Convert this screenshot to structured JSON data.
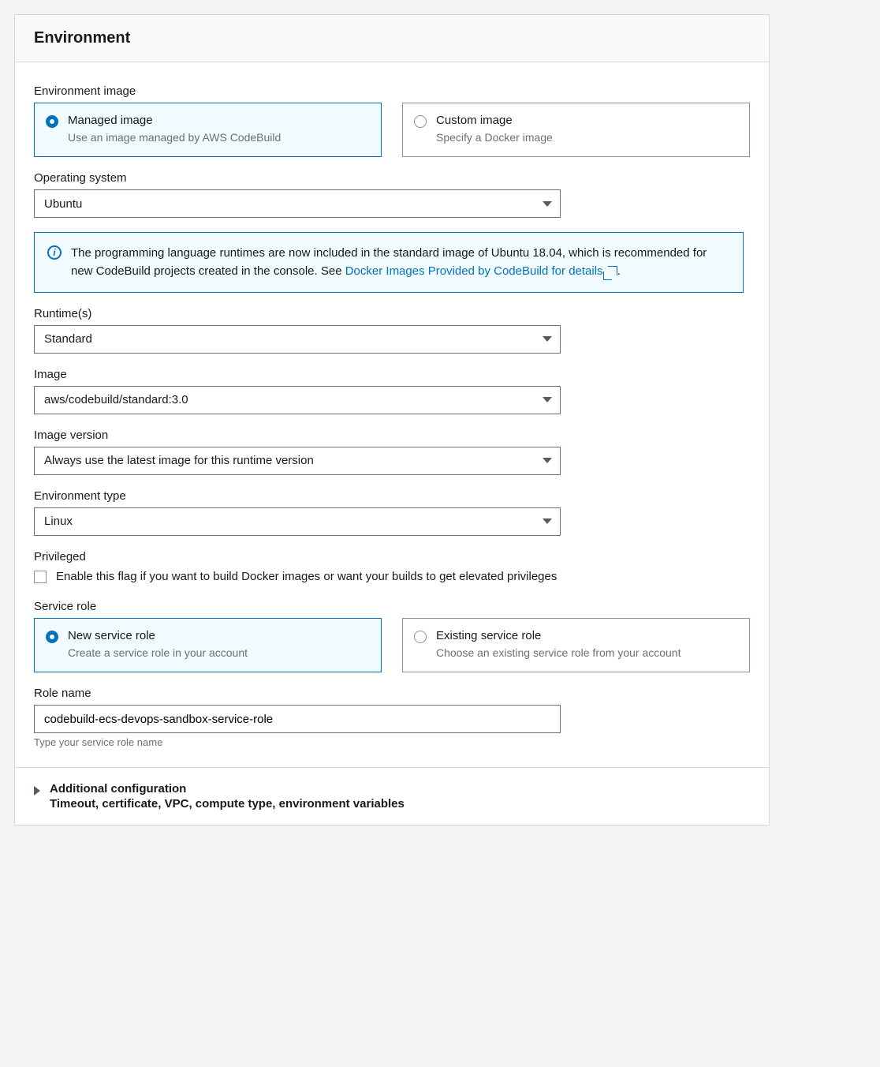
{
  "header": {
    "title": "Environment"
  },
  "envImage": {
    "label": "Environment image",
    "options": [
      {
        "title": "Managed image",
        "desc": "Use an image managed by AWS CodeBuild",
        "selected": true
      },
      {
        "title": "Custom image",
        "desc": "Specify a Docker image",
        "selected": false
      }
    ]
  },
  "os": {
    "label": "Operating system",
    "value": "Ubuntu"
  },
  "notice": {
    "text_before_link": "The programming language runtimes are now included in the standard image of Ubuntu 18.04, which is recommended for new CodeBuild projects created in the console. See ",
    "link_text": "Docker Images Provided by CodeBuild for details",
    "period": "."
  },
  "runtime": {
    "label": "Runtime(s)",
    "value": "Standard"
  },
  "image": {
    "label": "Image",
    "value": "aws/codebuild/standard:3.0"
  },
  "imageVersion": {
    "label": "Image version",
    "value": "Always use the latest image for this runtime version"
  },
  "envType": {
    "label": "Environment type",
    "value": "Linux"
  },
  "privileged": {
    "label": "Privileged",
    "checkbox_text": "Enable this flag if you want to build Docker images or want your builds to get elevated privileges",
    "checked": false
  },
  "serviceRole": {
    "label": "Service role",
    "options": [
      {
        "title": "New service role",
        "desc": "Create a service role in your account",
        "selected": true
      },
      {
        "title": "Existing service role",
        "desc": "Choose an existing service role from your account",
        "selected": false
      }
    ]
  },
  "roleName": {
    "label": "Role name",
    "value": "codebuild-ecs-devops-sandbox-service-role",
    "helper": "Type your service role name"
  },
  "additional": {
    "title": "Additional configuration",
    "desc": "Timeout, certificate, VPC, compute type, environment variables"
  }
}
